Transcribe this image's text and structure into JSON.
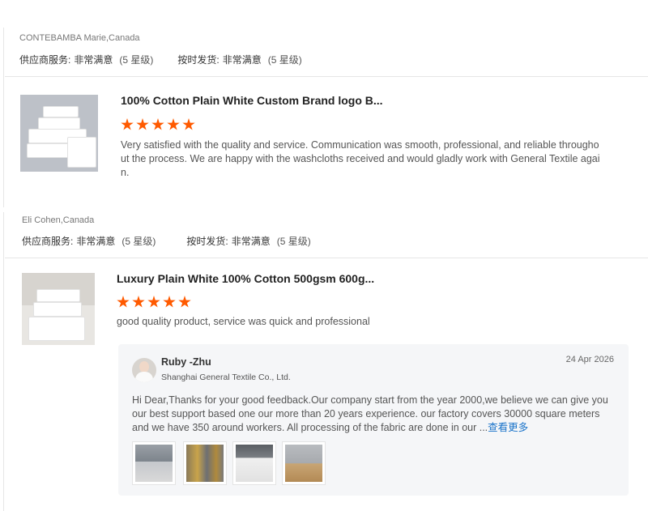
{
  "reviews": [
    {
      "reviewer": "CONTEBAMBA Marie,Canada",
      "supplier_service_label": "供应商服务:",
      "supplier_service_value": "非常满意",
      "supplier_service_level": "(5 星级)",
      "ontime_label": "按时发货:",
      "ontime_value": "非常满意",
      "ontime_level": "(5 星级)",
      "product_title": "100% Cotton Plain White Custom Brand logo B...",
      "rating": 5,
      "text_line1": "Very satisfied with the quality and service. Communication was smooth, professional, and reliable througho",
      "text_line2": "ut the process. We are happy with the washcloths received and would gladly work with General Textile agai",
      "text_line3": "n."
    },
    {
      "reviewer": "Eli Cohen,Canada",
      "supplier_service_label": "供应商服务:",
      "supplier_service_value": "非常满意",
      "supplier_service_level": "(5 星级)",
      "ontime_label": "按时发货:",
      "ontime_value": "非常满意",
      "ontime_level": "(5 星级)",
      "product_title": "Luxury Plain White 100% Cotton 500gsm 600g...",
      "rating": 5,
      "text": "good quality product, service was quick and professional",
      "reply": {
        "name": "Ruby -Zhu",
        "company": "Shanghai General Textile Co., Ltd.",
        "date": "24 Apr 2026",
        "line1": "Hi Dear,Thanks for your good feedback.Our company start from the year 2000,we believe we can give you",
        "line2": "our best support based one our more than 20 years experience. our factory covers 30000 square meters",
        "line3": "and we have 350 around workers. All processing of the fabric are done in our ...",
        "more": "查看更多"
      }
    }
  ],
  "icons": [
    "star-icon",
    "avatar"
  ],
  "colors": {
    "star": "#ff5a00",
    "link": "#1a73c9",
    "reply_bg": "#f5f6f8"
  }
}
